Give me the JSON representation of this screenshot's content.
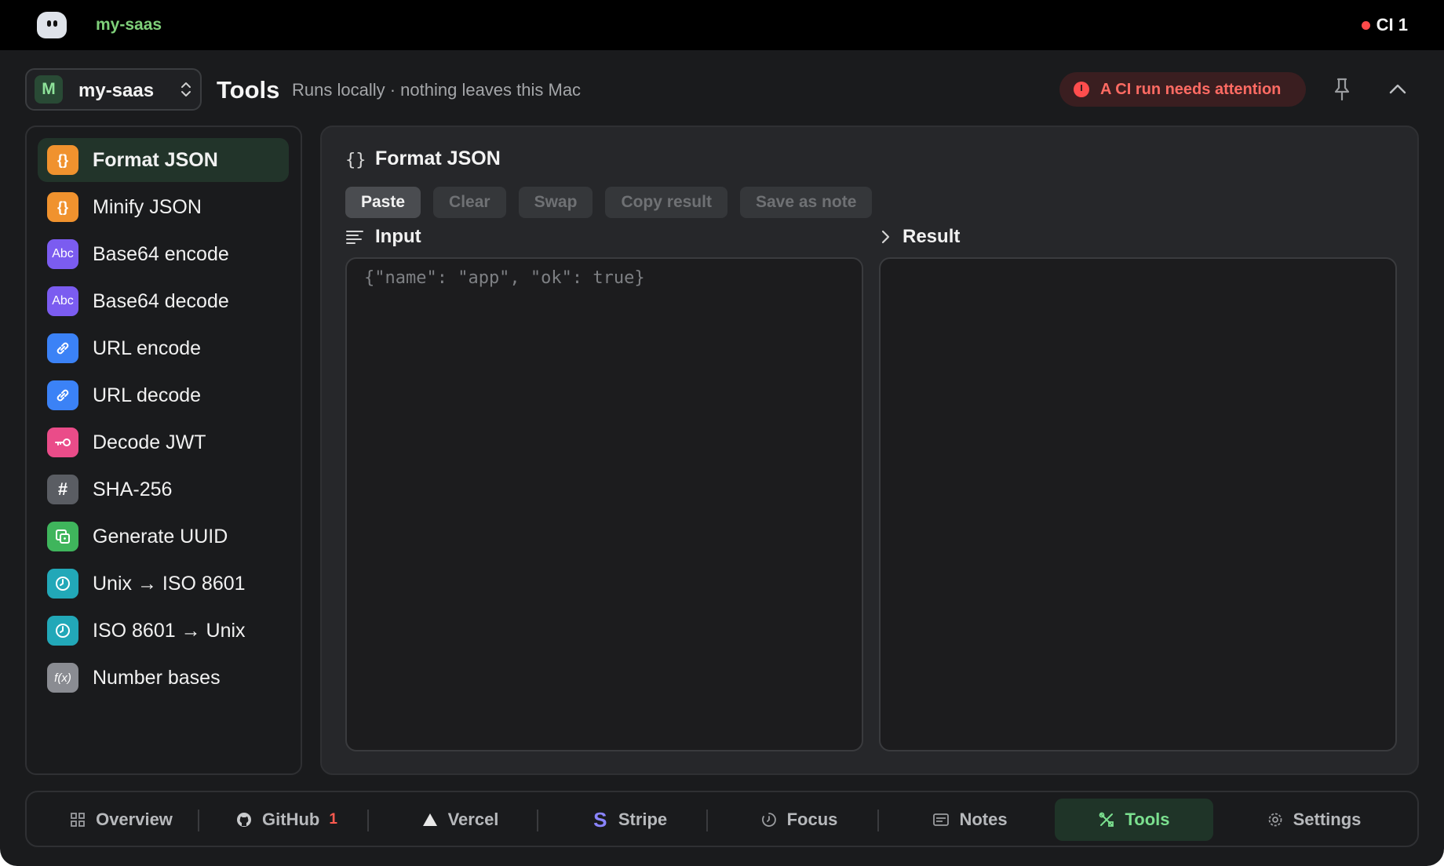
{
  "topbar": {
    "project": "my-saas",
    "ci_status": "CI 1"
  },
  "header": {
    "project_initial": "M",
    "project_name": "my-saas",
    "title": "Tools",
    "subtitle": "Runs locally · nothing leaves this Mac",
    "alert": "A CI run needs attention"
  },
  "sidebar": {
    "items": [
      {
        "label": "Format JSON",
        "icon_text": "{}",
        "icon": "braces-icon",
        "color": "#f0922e"
      },
      {
        "label": "Minify JSON",
        "icon_text": "{}",
        "icon": "braces-icon",
        "color": "#f0922e"
      },
      {
        "label": "Base64 encode",
        "icon_text": "Abc",
        "icon": "text-abc-icon",
        "color": "#7b5cf0"
      },
      {
        "label": "Base64 decode",
        "icon_text": "Abc",
        "icon": "text-abc-icon",
        "color": "#7b5cf0"
      },
      {
        "label": "URL encode",
        "icon_text": "🔗",
        "icon": "link-icon",
        "color": "#3b82f6"
      },
      {
        "label": "URL decode",
        "icon_text": "🔗",
        "icon": "link-icon",
        "color": "#3b82f6"
      },
      {
        "label": "Decode JWT",
        "icon_text": "⊸",
        "icon": "key-icon",
        "color": "#ea4c89"
      },
      {
        "label": "SHA-256",
        "icon_text": "#",
        "icon": "hash-icon",
        "color": "#5a5d63"
      },
      {
        "label": "Generate UUID",
        "icon_text": "⧉",
        "icon": "dice-icon",
        "color": "#3fb55c"
      },
      {
        "label": "Unix → ISO 8601",
        "icon_text": "◷",
        "icon": "clock-icon",
        "color": "#22a8b8"
      },
      {
        "label": "ISO 8601 → Unix",
        "icon_text": "◷",
        "icon": "clock-icon",
        "color": "#22a8b8"
      },
      {
        "label": "Number bases",
        "icon_text": "f(x)",
        "icon": "function-icon",
        "color": "#8a8c92"
      }
    ]
  },
  "tool": {
    "icon_text": "{}",
    "title": "Format JSON",
    "actions": [
      "Paste",
      "Clear",
      "Swap",
      "Copy result",
      "Save as note"
    ],
    "input_label": "Input",
    "result_label": "Result",
    "input_placeholder": "{\"name\": \"app\", \"ok\": true}"
  },
  "bottom_nav": {
    "overview": "Overview",
    "github": "GitHub",
    "github_badge": "1",
    "vercel": "Vercel",
    "stripe": "Stripe",
    "stripe_icon": "S",
    "focus": "Focus",
    "notes": "Notes",
    "tools": "Tools",
    "settings": "Settings"
  },
  "colors": {
    "accent": "#7be08f",
    "alert": "#ff6b63",
    "background": "#1a1b1d"
  }
}
